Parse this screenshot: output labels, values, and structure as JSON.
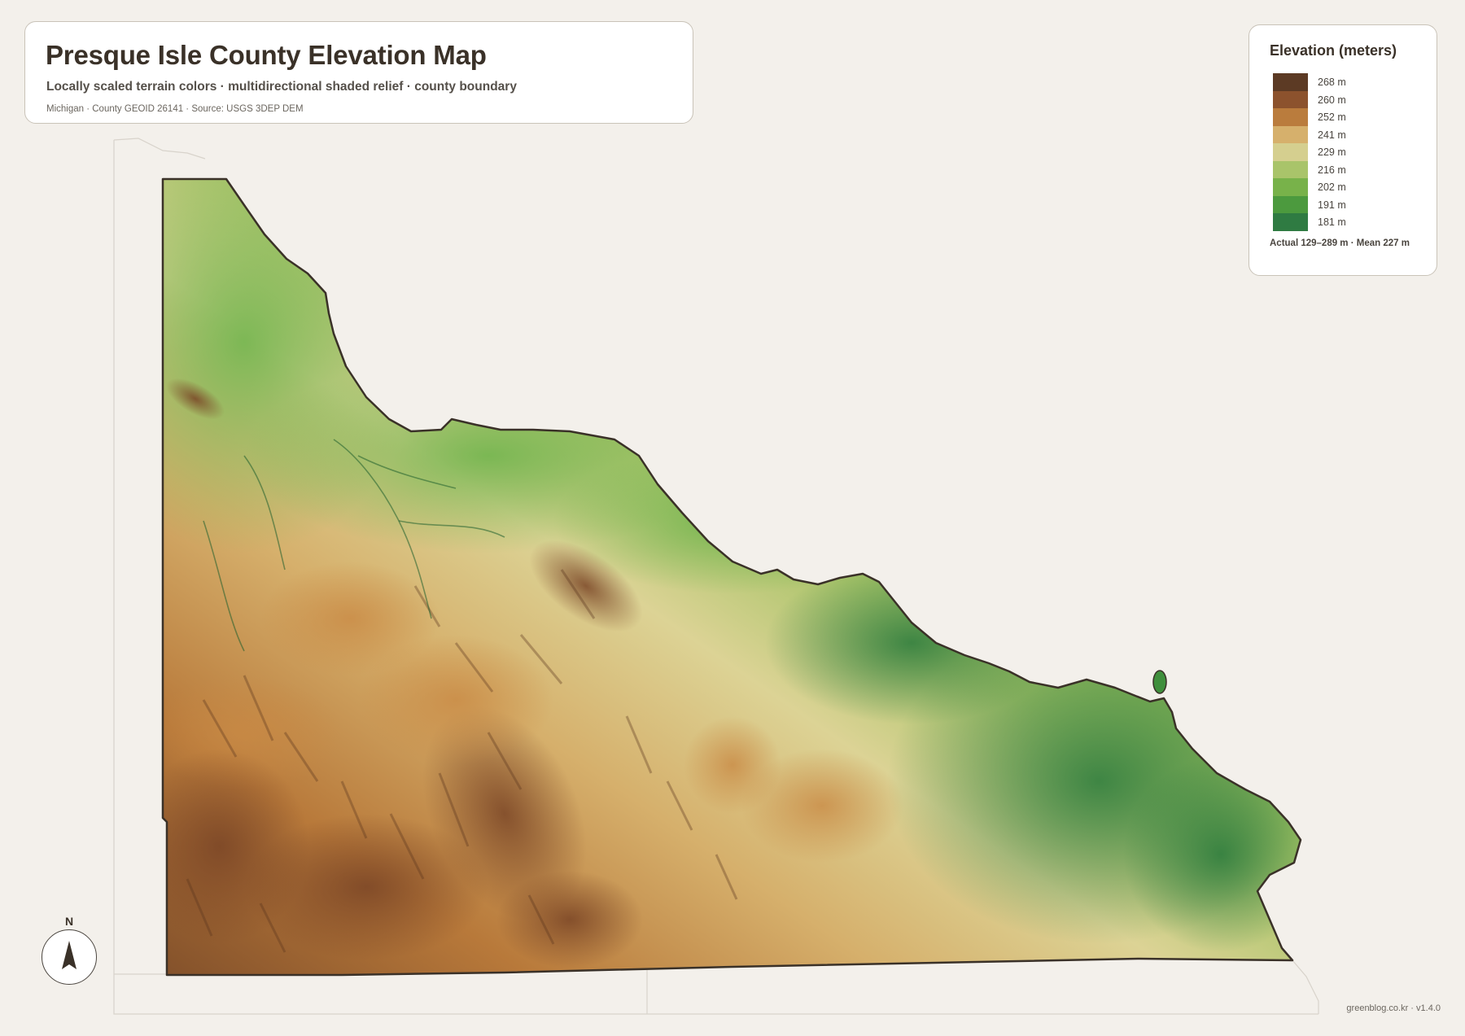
{
  "title_card": {
    "title": "Presque Isle County Elevation Map",
    "subtitle": "Locally scaled terrain colors · multidirectional shaded relief · county boundary",
    "meta": "Michigan · County GEOID 26141 · Source: USGS 3DEP DEM"
  },
  "legend": {
    "title": "Elevation (meters)",
    "items": [
      {
        "label": "268 m",
        "color": "#5c3a24"
      },
      {
        "label": "260 m",
        "color": "#8c522d"
      },
      {
        "label": "252 m",
        "color": "#ba7c3d"
      },
      {
        "label": "241 m",
        "color": "#d6b06c"
      },
      {
        "label": "229 m",
        "color": "#d5cf8f"
      },
      {
        "label": "216 m",
        "color": "#a9c46a"
      },
      {
        "label": "202 m",
        "color": "#78b24a"
      },
      {
        "label": "191 m",
        "color": "#4c9a3e"
      },
      {
        "label": "181 m",
        "color": "#2f7b42"
      }
    ],
    "note": "Actual 129–289 m · Mean 227 m"
  },
  "north_arrow": {
    "letter": "N"
  },
  "credit": "greenblog.co.kr · v1.4.0",
  "colors": {
    "background": "#f3f0eb",
    "boundary": "#3a3128",
    "neighbor_outline": "#d8d3cb"
  }
}
